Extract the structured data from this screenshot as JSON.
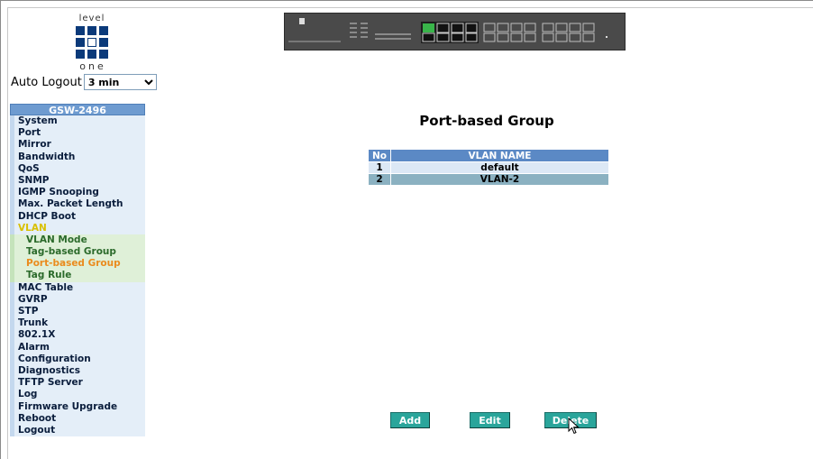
{
  "logo": {
    "top_text": "level",
    "bottom_text": "one"
  },
  "auto_logout": {
    "label": "Auto Logout",
    "selected": "3 min"
  },
  "menu": {
    "header": "GSW-2496",
    "items_before": [
      "System",
      "Port",
      "Mirror",
      "Bandwidth",
      "QoS",
      "SNMP",
      "IGMP Snooping",
      "Max. Packet Length",
      "DHCP Boot"
    ],
    "vlan_label": "VLAN",
    "vlan_sub": [
      "VLAN Mode",
      "Tag-based Group",
      "Port-based Group",
      "Tag Rule"
    ],
    "active_sub": "Port-based Group",
    "items_after": [
      "MAC Table",
      "GVRP",
      "STP",
      "Trunk",
      "802.1X",
      "Alarm",
      "Configuration",
      "Diagnostics",
      "TFTP Server",
      "Log",
      "Firmware Upgrade",
      "Reboot",
      "Logout"
    ]
  },
  "page": {
    "title": "Port-based Group",
    "table": {
      "headers": [
        "No",
        "VLAN NAME"
      ],
      "rows": [
        [
          "1",
          "default"
        ],
        [
          "2",
          "VLAN-2"
        ]
      ]
    },
    "buttons": {
      "add": "Add",
      "edit": "Edit",
      "delete": "Delete"
    }
  },
  "colors": {
    "menu_header": "#6e9bd0",
    "button": "#2aa59b",
    "active_sub": "#ea8b1d",
    "vlan_label": "#d9c000"
  }
}
